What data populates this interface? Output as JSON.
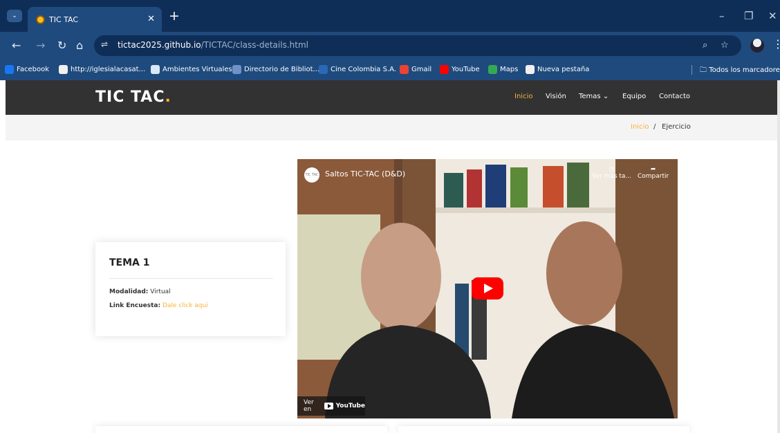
{
  "browser": {
    "tab_title": "TIC TAC",
    "url_host": "tictac2025.github.io",
    "url_path": "/TICTAC/class-details.html",
    "bookmarks": [
      {
        "label": "Facebook",
        "color": "#1877f2"
      },
      {
        "label": "http://iglesialacasat...",
        "color": "#f0f0f0"
      },
      {
        "label": "Ambientes Virtuales",
        "color": "#d8e8f8"
      },
      {
        "label": "Directorio de Bibliot...",
        "color": "#6f93c8"
      },
      {
        "label": "Cine Colombia S.A.",
        "color": "#2a68b8"
      },
      {
        "label": "Gmail",
        "color": "#ea4335"
      },
      {
        "label": "YouTube",
        "color": "#ff0000"
      },
      {
        "label": "Maps",
        "color": "#34a853"
      },
      {
        "label": "Nueva pestaña",
        "color": "#f0f0f0"
      }
    ],
    "all_bookmarks": "Todos los marcadores"
  },
  "site": {
    "logo": "TIC TAC",
    "logo_dot": ".",
    "menu": [
      "Inicio",
      "Visión",
      "Temas",
      "Equipo",
      "Contacto"
    ],
    "breadcrumb": {
      "home": "Inicio",
      "separator": "/",
      "current": "Ejercicio"
    }
  },
  "course_card": {
    "title": "TEMA 1",
    "modalidad_label": "Modalidad:",
    "modalidad_value": "Virtual",
    "encuesta_label": "Link Encuesta:",
    "encuesta_link": "Dale click aqui"
  },
  "video": {
    "title": "Saltos TIC-TAC (D&D)",
    "channel_icon_text": "TIC TAC",
    "watch_later": "Ver más ta...",
    "share": "Compartir",
    "watch_on": "Ver en",
    "platform": "YouTube"
  },
  "colors": {
    "accent": "#f7b23b",
    "nav_bg": "#333232",
    "chrome": "#1f4a7d"
  }
}
